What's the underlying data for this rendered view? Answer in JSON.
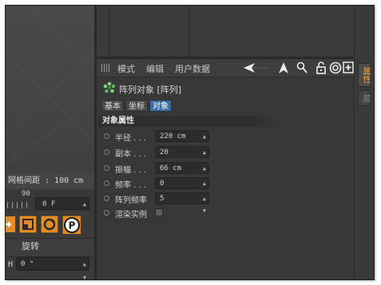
{
  "viewport": {
    "grid_spacing_label": "网格间距 : 100 cm"
  },
  "timeline": {
    "ruler_value": "90",
    "frame_value": "0 F"
  },
  "rotate_panel": {
    "title": "旋转",
    "h_label": "H",
    "h_value": "0 °"
  },
  "menubar": {
    "items": [
      "模式",
      "编辑",
      "用户数据"
    ]
  },
  "object": {
    "title": "阵列对象 [阵列]"
  },
  "tabs": [
    "基本",
    "坐标",
    "对象"
  ],
  "active_tab": "对象",
  "section_title": "对象属性",
  "properties": [
    {
      "label": "半径 . . .",
      "value": "220 cm",
      "control": "spinner"
    },
    {
      "label": "副本 . . .",
      "value": "20",
      "control": "spinner"
    },
    {
      "label": "振幅 . . .",
      "value": "66 cm",
      "control": "spinner"
    },
    {
      "label": "频率 . . .",
      "value": "0",
      "control": "spinner"
    },
    {
      "label": "阵列频率",
      "value": "5",
      "control": "spinner"
    },
    {
      "label": "渲染实例",
      "value": "",
      "control": "checkbox"
    }
  ],
  "right_tabs": {
    "active": "属性",
    "inactive": "层"
  },
  "colors": {
    "background": "#3a3a3a",
    "field": "#2c2c2c",
    "active_tab": "#3d6fa6",
    "right_tab_active_text": "#f3a33a",
    "tool_orange": "#e38b25",
    "tool_blue": "#4a74b8"
  },
  "icons": [
    "arrow-left-icon",
    "arrow-up-icon",
    "search-icon",
    "lock-icon",
    "target-icon",
    "new-panel-icon",
    "array-object-icon",
    "move-tool-icon",
    "scale-tool-icon",
    "rotate-tool-icon",
    "pan-tool-icon"
  ]
}
